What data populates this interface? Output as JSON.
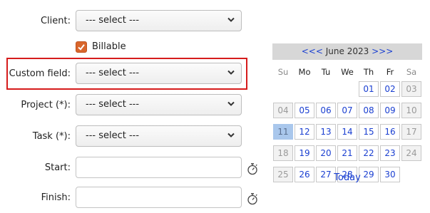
{
  "form": {
    "client": {
      "label": "Client:",
      "value": "--- select ---"
    },
    "billable": {
      "label": "Billable",
      "checked": true
    },
    "custom_field": {
      "label": "Custom field:",
      "value": "--- select ---"
    },
    "project": {
      "label": "Project (*):",
      "value": "--- select ---"
    },
    "task": {
      "label": "Task (*):",
      "value": "--- select ---"
    },
    "start": {
      "label": "Start:",
      "value": ""
    },
    "finish": {
      "label": "Finish:",
      "value": ""
    }
  },
  "calendar": {
    "prev": "<<<",
    "month_year": "June 2023",
    "next": ">>>",
    "weekdays": [
      "Su",
      "Mo",
      "Tu",
      "We",
      "Th",
      "Fr",
      "Sa"
    ],
    "weeks": [
      [
        "",
        "",
        "",
        "",
        "01",
        "02",
        "03"
      ],
      [
        "04",
        "05",
        "06",
        "07",
        "08",
        "09",
        "10"
      ],
      [
        "11",
        "12",
        "13",
        "14",
        "15",
        "16",
        "17"
      ],
      [
        "18",
        "19",
        "20",
        "21",
        "22",
        "23",
        "24"
      ],
      [
        "25",
        "26",
        "27",
        "28",
        "29",
        "30",
        ""
      ]
    ],
    "selected_day": "11",
    "today_link": "Today"
  },
  "colors": {
    "highlight_border": "#d61c1c",
    "checkbox": "#d9662c",
    "link": "#1a3fd1",
    "selected_day": "#a9c7ec"
  }
}
